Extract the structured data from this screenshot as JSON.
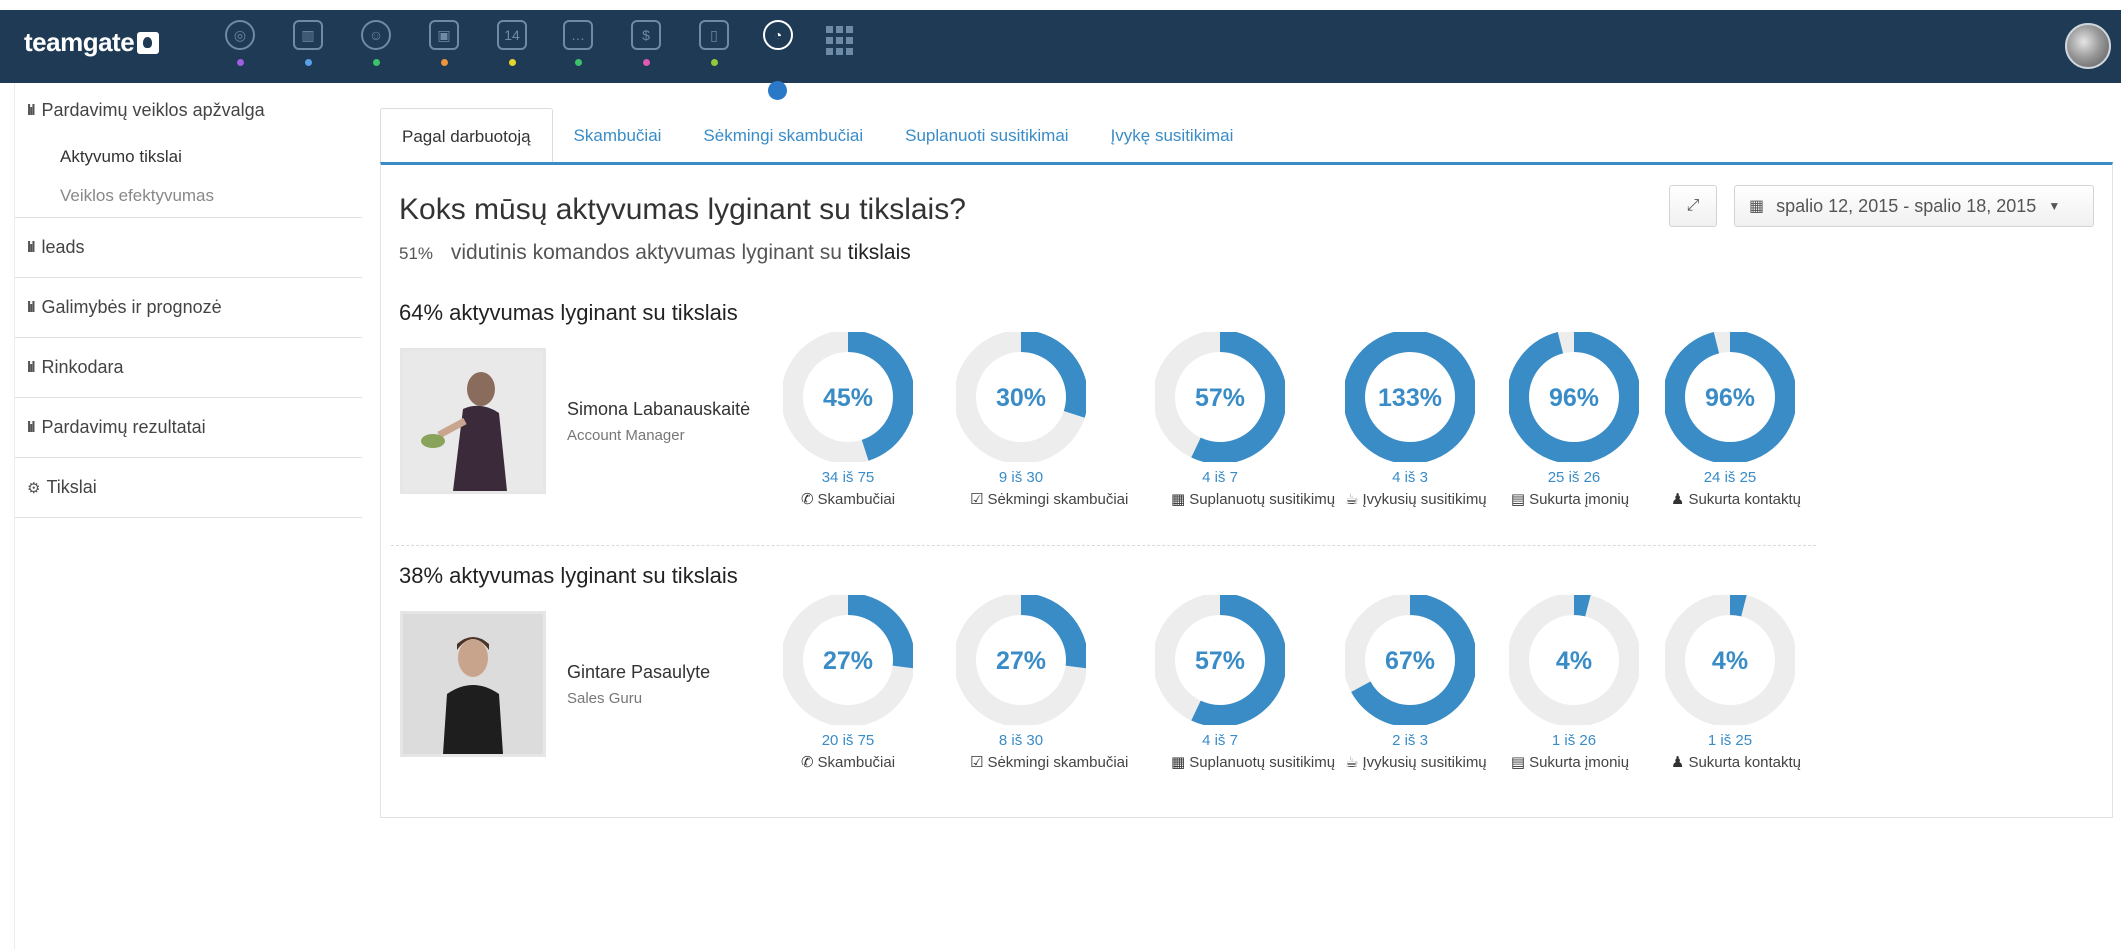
{
  "app": {
    "logo": "teamgate"
  },
  "colors": {
    "accent": "#3a8cc7",
    "topbar": "#1f3a55",
    "ring_track": "#ededed"
  },
  "topnav": {
    "icons": [
      {
        "name": "target-icon",
        "glyph": "◎",
        "dot": "#a05ee2"
      },
      {
        "name": "building-icon",
        "glyph": "▥",
        "dot": "#5aa0e6"
      },
      {
        "name": "people-icon",
        "glyph": "☺",
        "dot": "#3cc36a"
      },
      {
        "name": "briefcase-icon",
        "glyph": "▣",
        "dot": "#f0953a"
      },
      {
        "name": "calendar-icon",
        "glyph": "14",
        "dot": "#e5d42c"
      },
      {
        "name": "chat-icon",
        "glyph": "…",
        "dot": "#3cc36a"
      },
      {
        "name": "bag-icon",
        "glyph": "$",
        "dot": "#e05ab4"
      },
      {
        "name": "clipboard-icon",
        "glyph": "▯",
        "dot": "#94c93a"
      },
      {
        "name": "chart-pie-icon",
        "glyph": "◔",
        "dot": "#2a78c8",
        "active": true
      }
    ]
  },
  "sidebar": {
    "sections": [
      {
        "label": "Pardavimų veiklos apžvalga",
        "sub": [
          "Aktyvumo tikslai",
          "Veiklos efektyvumas"
        ]
      },
      {
        "label": "leads"
      },
      {
        "label": "Galimybės ir prognozė"
      },
      {
        "label": "Rinkodara"
      },
      {
        "label": "Pardavimų rezultatai"
      },
      {
        "label": "Tikslai"
      }
    ]
  },
  "tabs": [
    "Pagal darbuotoją",
    "Skambučiai",
    "Sėkmingi skambučiai",
    "Suplanuoti susitikimai",
    "Įvykę susitikimai"
  ],
  "panel": {
    "title": "Koks mūsų aktyvumas lyginant su tikslais?",
    "subtitle_pct": "51%",
    "subtitle_text": "vidutinis komandos aktyvumas lyginant su",
    "subtitle_strong": "tikslais",
    "date_range": "spalio 12, 2015 - spalio 18, 2015"
  },
  "members": [
    {
      "heading": "64% aktyvumas lyginant su tikslais",
      "name": "Simona Labanauskaitė",
      "role": "Account Manager",
      "metrics": [
        {
          "pct_label": "45%",
          "fraction": 0.45,
          "count": "34 iš 75",
          "label": "Skambučiai",
          "icon": "✆"
        },
        {
          "pct_label": "30%",
          "fraction": 0.3,
          "count": "9 iš 30",
          "label": "Sėkmingi skambučiai",
          "icon": "☑"
        },
        {
          "pct_label": "57%",
          "fraction": 0.57,
          "count": "4 iš 7",
          "label": "Suplanuotų susitikimų",
          "icon": "▦"
        },
        {
          "pct_label": "133%",
          "fraction": 1.33,
          "count": "4 iš 3",
          "label": "Įvykusių susitikimų",
          "icon": "☕"
        },
        {
          "pct_label": "96%",
          "fraction": 0.96,
          "count": "25 iš 26",
          "label": "Sukurta įmonių",
          "icon": "▤"
        },
        {
          "pct_label": "96%",
          "fraction": 0.96,
          "count": "24 iš 25",
          "label": "Sukurta kontaktų",
          "icon": "♟"
        }
      ]
    },
    {
      "heading": "38% aktyvumas lyginant su tikslais",
      "name": "Gintare Pasaulyte",
      "role": "Sales Guru",
      "metrics": [
        {
          "pct_label": "27%",
          "fraction": 0.27,
          "count": "20 iš 75",
          "label": "Skambučiai",
          "icon": "✆"
        },
        {
          "pct_label": "27%",
          "fraction": 0.27,
          "count": "8 iš 30",
          "label": "Sėkmingi skambučiai",
          "icon": "☑"
        },
        {
          "pct_label": "57%",
          "fraction": 0.57,
          "count": "4 iš 7",
          "label": "Suplanuotų susitikimų",
          "icon": "▦"
        },
        {
          "pct_label": "67%",
          "fraction": 0.67,
          "count": "2 iš 3",
          "label": "Įvykusių susitikimų",
          "icon": "☕"
        },
        {
          "pct_label": "4%",
          "fraction": 0.04,
          "count": "1 iš 26",
          "label": "Sukurta įmonių",
          "icon": "▤"
        },
        {
          "pct_label": "4%",
          "fraction": 0.04,
          "count": "1 iš 25",
          "label": "Sukurta kontaktų",
          "icon": "♟"
        }
      ]
    }
  ]
}
